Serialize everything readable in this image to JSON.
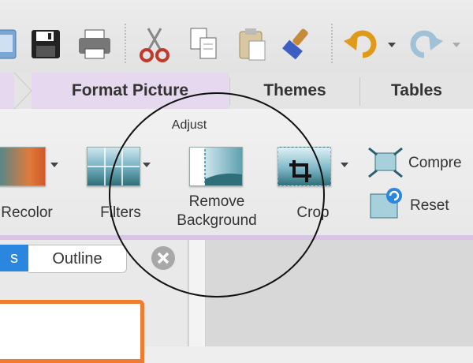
{
  "toolbar": {
    "icons": [
      "new-document-icon",
      "save-icon",
      "print-icon",
      "cut-icon",
      "copy-icon",
      "paste-icon",
      "format-painter-icon",
      "undo-icon",
      "redo-icon"
    ]
  },
  "tabs": {
    "format_picture": "Format Picture",
    "themes": "Themes",
    "tables": "Tables"
  },
  "ribbon": {
    "group_label": "Adjust",
    "recolor": "Recolor",
    "filters": "Filters",
    "remove_background_line1": "Remove",
    "remove_background_line2": "Background",
    "crop": "Crop",
    "compress": "Compre",
    "reset": "Reset"
  },
  "sidebar": {
    "tab_outline": "Outline",
    "tab_slides_fragment": "s"
  },
  "colors": {
    "active_tab": "#e6d8ee",
    "ribbon_accent": "#d8c5e6",
    "slide_border": "#f07c30",
    "segment_active": "#2b86e0"
  }
}
